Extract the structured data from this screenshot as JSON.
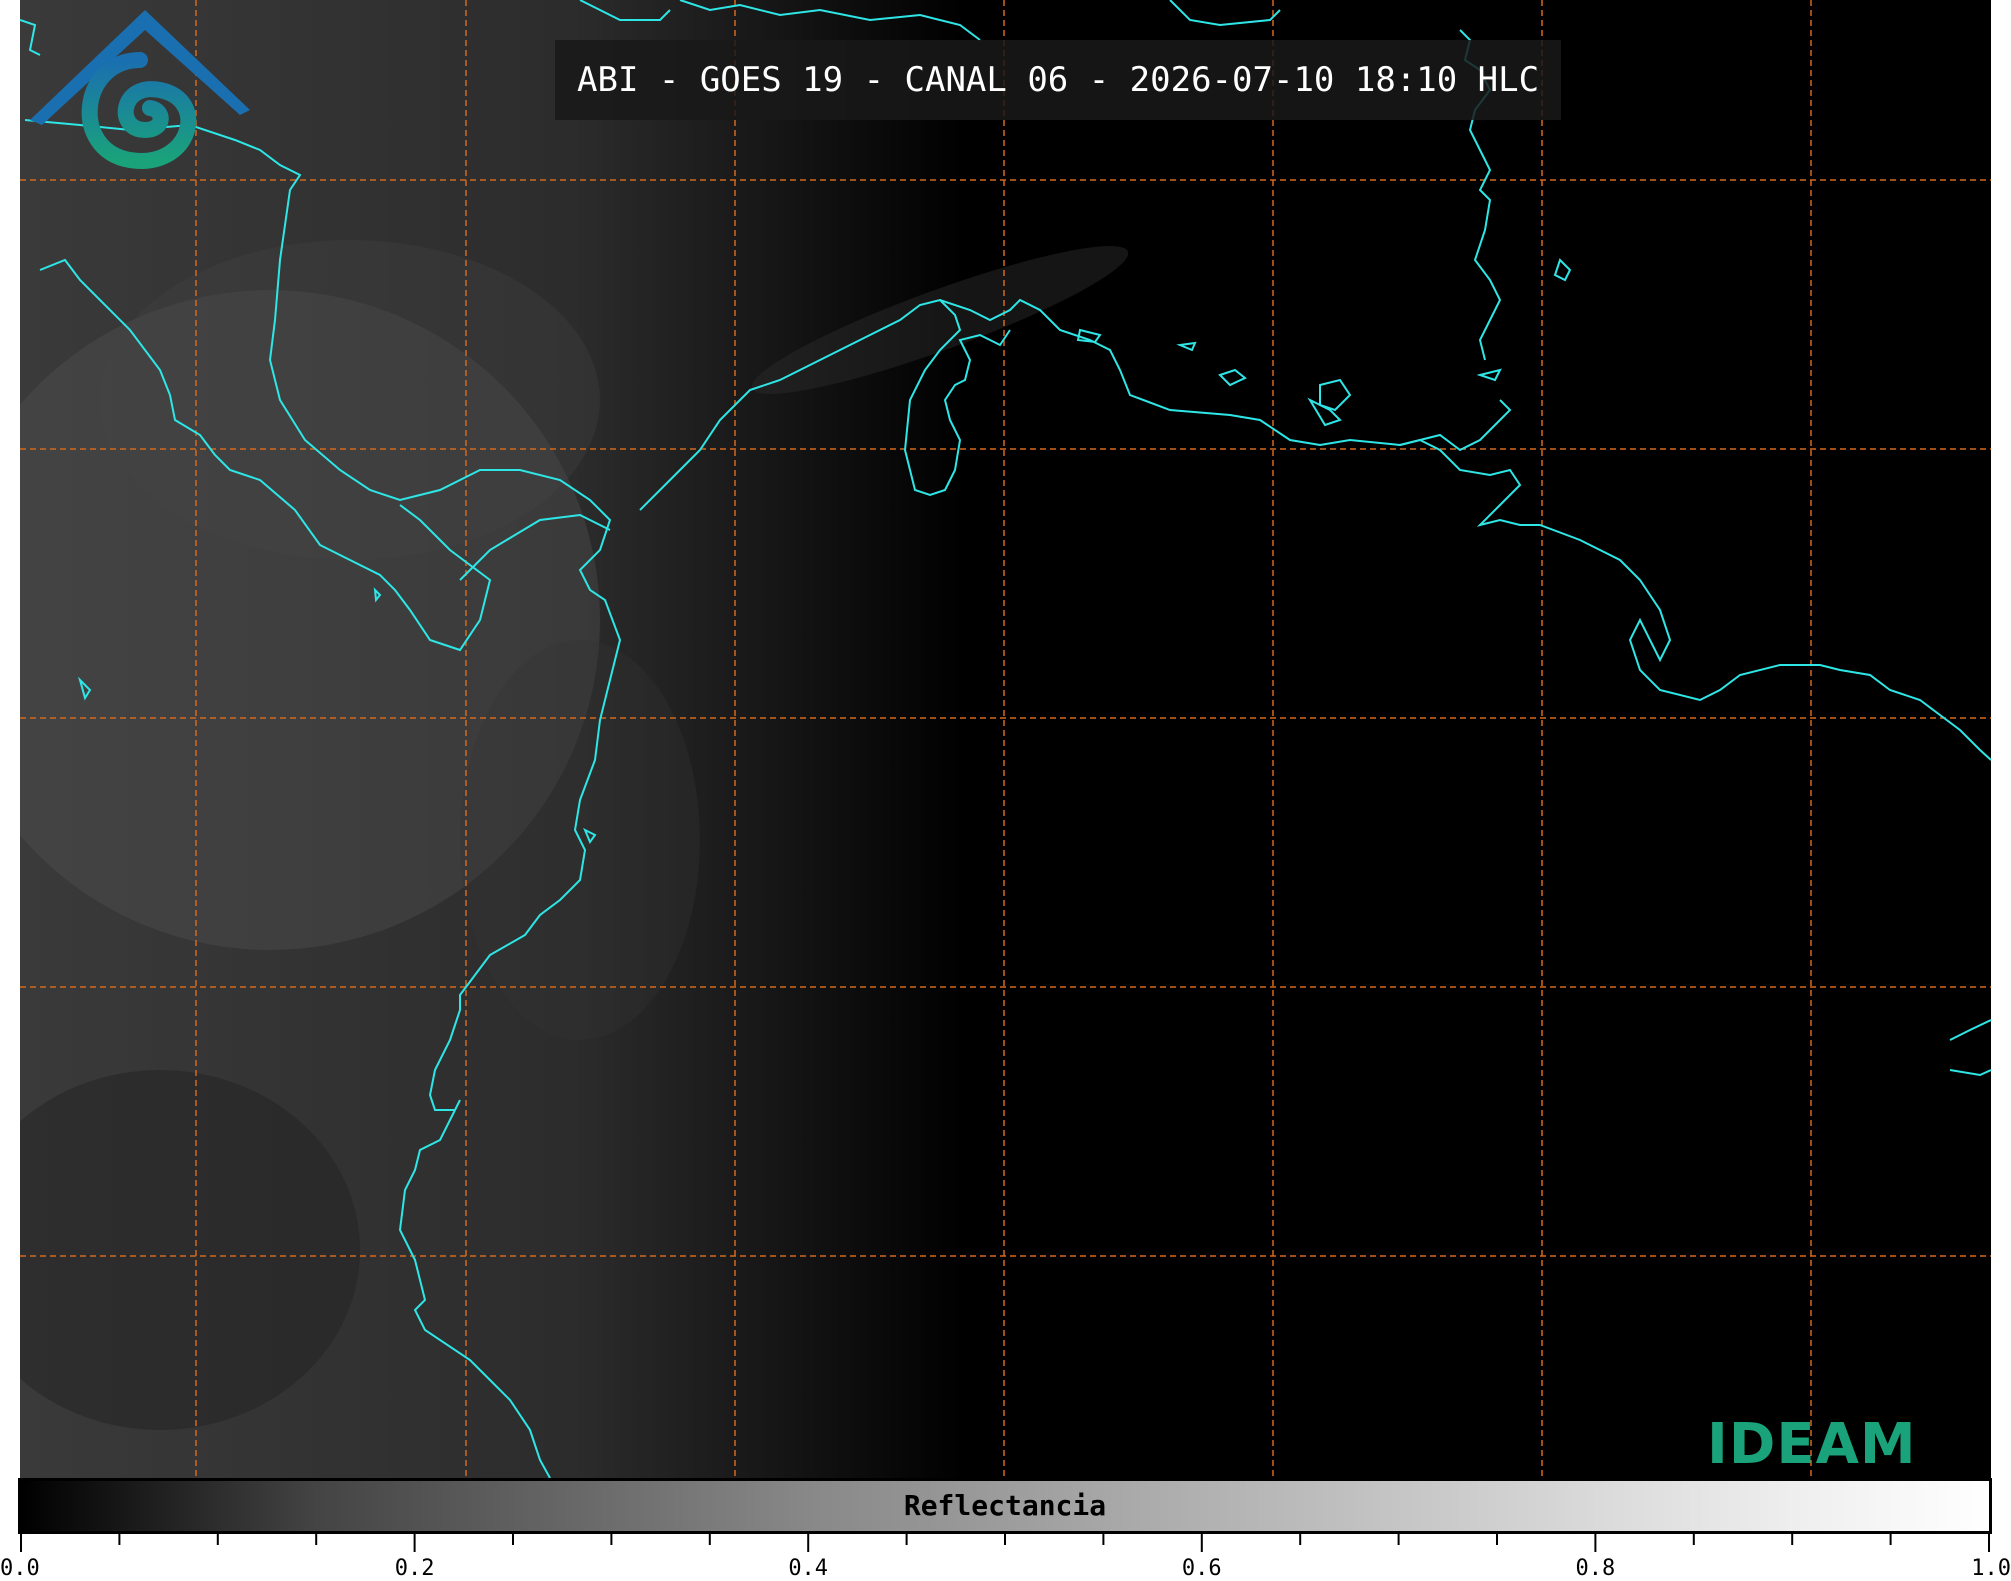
{
  "title": "ABI - GOES 19 - CANAL 06 - 2026-07-10 18:10 HLC",
  "colorbar": {
    "label": "Reflectancia",
    "min": 0.0,
    "max": 1.0,
    "major_ticks": [
      "0.0",
      "0.2",
      "0.4",
      "0.6",
      "0.8",
      "1.0"
    ],
    "minor_step": 0.05
  },
  "logo": {
    "text": "IDEAM",
    "icon": "ideam-mountain-spiral-icon"
  },
  "colors": {
    "coastline": "#2ee6e6",
    "grid": "#d2691e",
    "title_bg": "#191919",
    "logo_green": "#1aa37a",
    "logo_blue": "#1a6fb0"
  },
  "map": {
    "grid_lines": "dashed",
    "grid_columns": 7,
    "grid_rows": 5
  }
}
